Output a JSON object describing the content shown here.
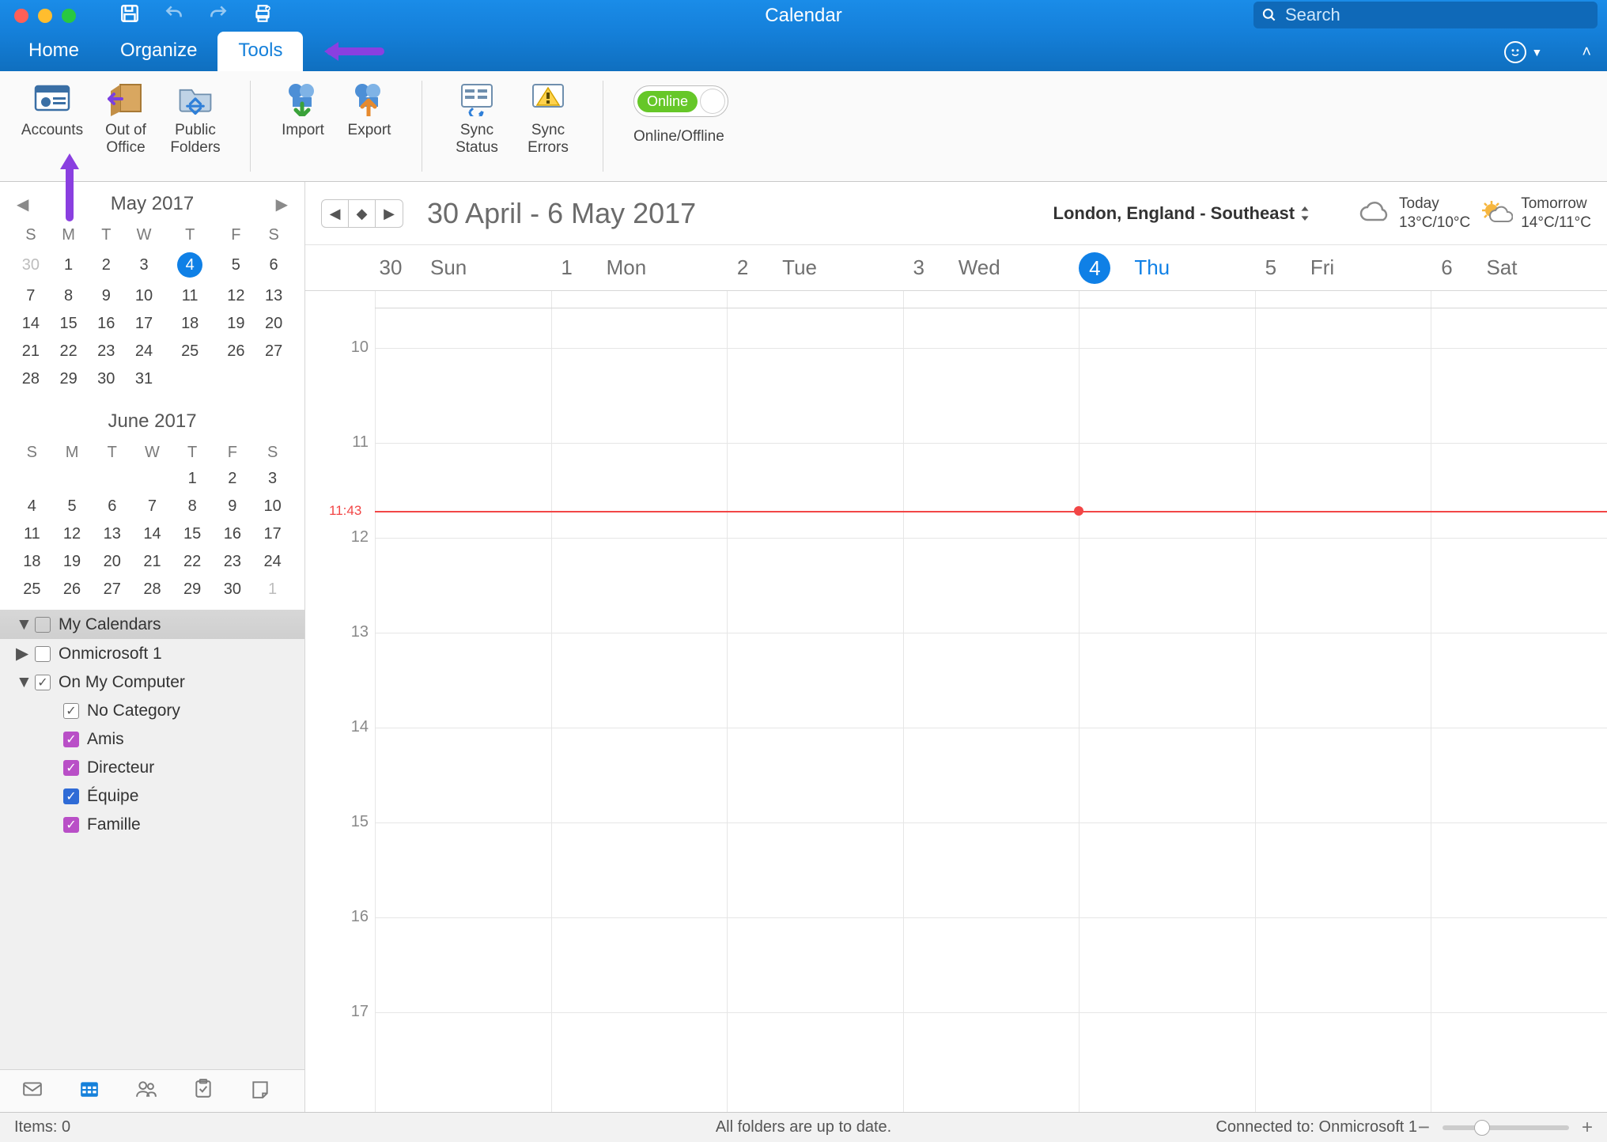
{
  "window": {
    "title": "Calendar"
  },
  "search": {
    "placeholder": "Search"
  },
  "tabs": {
    "home": "Home",
    "organize": "Organize",
    "tools": "Tools"
  },
  "ribbon": {
    "accounts": "Accounts",
    "out_of_office": "Out of\nOffice",
    "public_folders": "Public\nFolders",
    "import": "Import",
    "export": "Export",
    "sync_status": "Sync\nStatus",
    "sync_errors": "Sync\nErrors",
    "online_pill": "Online",
    "online_label": "Online/Offline"
  },
  "minical1": {
    "title": "May 2017",
    "dow": [
      "S",
      "M",
      "T",
      "W",
      "T",
      "F",
      "S"
    ],
    "rows": [
      [
        {
          "d": "30",
          "g": true
        },
        {
          "d": "1"
        },
        {
          "d": "2"
        },
        {
          "d": "3"
        },
        {
          "d": "4",
          "today": true
        },
        {
          "d": "5"
        },
        {
          "d": "6"
        }
      ],
      [
        {
          "d": "7"
        },
        {
          "d": "8"
        },
        {
          "d": "9"
        },
        {
          "d": "10"
        },
        {
          "d": "11"
        },
        {
          "d": "12"
        },
        {
          "d": "13"
        }
      ],
      [
        {
          "d": "14"
        },
        {
          "d": "15"
        },
        {
          "d": "16"
        },
        {
          "d": "17"
        },
        {
          "d": "18"
        },
        {
          "d": "19"
        },
        {
          "d": "20"
        }
      ],
      [
        {
          "d": "21"
        },
        {
          "d": "22"
        },
        {
          "d": "23"
        },
        {
          "d": "24"
        },
        {
          "d": "25"
        },
        {
          "d": "26"
        },
        {
          "d": "27"
        }
      ],
      [
        {
          "d": "28"
        },
        {
          "d": "29"
        },
        {
          "d": "30"
        },
        {
          "d": "31"
        },
        {
          "d": ""
        },
        {
          "d": ""
        },
        {
          "d": ""
        }
      ]
    ]
  },
  "minical2": {
    "title": "June 2017",
    "dow": [
      "S",
      "M",
      "T",
      "W",
      "T",
      "F",
      "S"
    ],
    "rows": [
      [
        {
          "d": ""
        },
        {
          "d": ""
        },
        {
          "d": ""
        },
        {
          "d": ""
        },
        {
          "d": "1"
        },
        {
          "d": "2"
        },
        {
          "d": "3"
        }
      ],
      [
        {
          "d": "4"
        },
        {
          "d": "5"
        },
        {
          "d": "6"
        },
        {
          "d": "7"
        },
        {
          "d": "8"
        },
        {
          "d": "9"
        },
        {
          "d": "10"
        }
      ],
      [
        {
          "d": "11"
        },
        {
          "d": "12"
        },
        {
          "d": "13"
        },
        {
          "d": "14"
        },
        {
          "d": "15"
        },
        {
          "d": "16"
        },
        {
          "d": "17"
        }
      ],
      [
        {
          "d": "18"
        },
        {
          "d": "19"
        },
        {
          "d": "20"
        },
        {
          "d": "21"
        },
        {
          "d": "22"
        },
        {
          "d": "23"
        },
        {
          "d": "24"
        }
      ],
      [
        {
          "d": "25"
        },
        {
          "d": "26"
        },
        {
          "d": "27"
        },
        {
          "d": "28"
        },
        {
          "d": "29"
        },
        {
          "d": "30"
        },
        {
          "d": "1",
          "g": true
        }
      ]
    ]
  },
  "calendars": {
    "header": "My Calendars",
    "items": [
      {
        "label": "Onmicrosoft 1",
        "checked": false,
        "expand": "right",
        "indent": 0,
        "color": "#fff"
      },
      {
        "label": "On My Computer",
        "checked": true,
        "expand": "down",
        "indent": 0,
        "color": "#fff"
      },
      {
        "label": "No Category",
        "checked": true,
        "indent": 1,
        "color": "#fff"
      },
      {
        "label": "Amis",
        "checked": true,
        "indent": 1,
        "color": "#b94fc7"
      },
      {
        "label": "Directeur",
        "checked": true,
        "indent": 1,
        "color": "#b94fc7"
      },
      {
        "label": "Équipe",
        "checked": true,
        "indent": 1,
        "color": "#2f6bd6"
      },
      {
        "label": "Famille",
        "checked": true,
        "indent": 1,
        "color": "#b94fc7"
      }
    ]
  },
  "calheader": {
    "range": "30 April - 6 May 2017",
    "location": "London, England - Southeast",
    "today_label": "Today",
    "today_temp": "13°C/10°C",
    "tomorrow_label": "Tomorrow",
    "tomorrow_temp": "14°C/11°C"
  },
  "days": [
    {
      "num": "30",
      "name": "Sun"
    },
    {
      "num": "1",
      "name": "Mon"
    },
    {
      "num": "2",
      "name": "Tue"
    },
    {
      "num": "3",
      "name": "Wed"
    },
    {
      "num": "4",
      "name": "Thu",
      "active": true
    },
    {
      "num": "5",
      "name": "Fri"
    },
    {
      "num": "6",
      "name": "Sat"
    }
  ],
  "hours": [
    "",
    "10",
    "11",
    "12",
    "13",
    "14",
    "15",
    "16",
    "17"
  ],
  "now": "11:43",
  "status": {
    "items": "Items: 0",
    "sync": "All folders are up to date.",
    "conn": "Connected to: Onmicrosoft 1"
  }
}
